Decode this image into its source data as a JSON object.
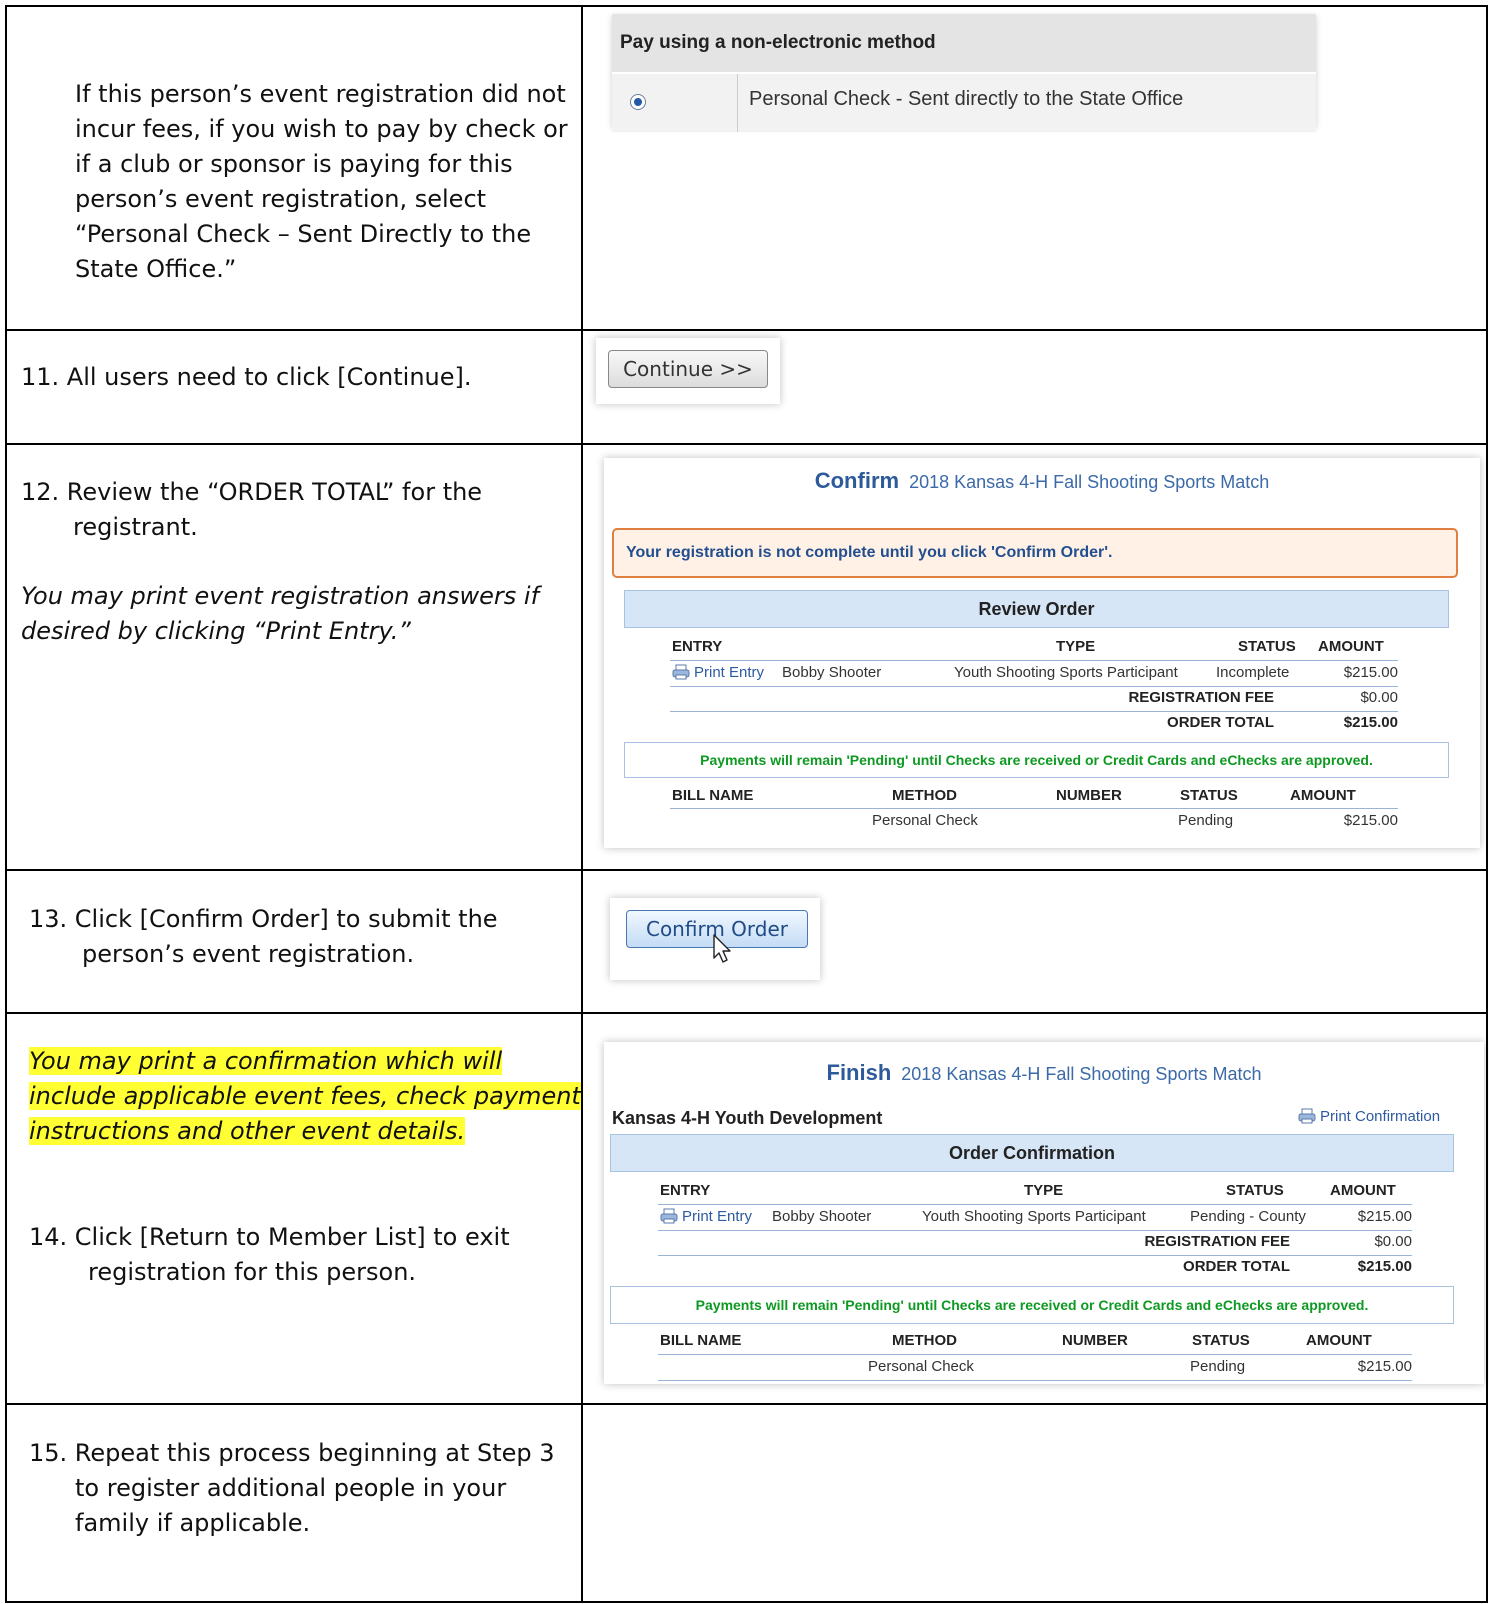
{
  "rows": [
    {
      "text": [
        "If this person’s event registration did not",
        "incur fees, if you wish to pay by check or",
        "if a club or sponsor is paying for this",
        "person’s event registration, select",
        "“Personal Check – Sent Directly to the",
        "State Office.”"
      ]
    },
    {
      "text": "11.  All users need to click [Continue]."
    },
    {
      "text": [
        "12.  Review the “ORDER TOTAL” for the",
        "registrant."
      ],
      "italic": [
        "You may print event registration answers if",
        "desired by clicking “Print Entry.”"
      ]
    },
    {
      "text": [
        "13.  Click [Confirm Order] to submit the",
        "person’s event registration."
      ]
    },
    {
      "highlight": [
        "You may print a confirmation which will",
        "include applicable event fees, check payment",
        "instructions and other event details."
      ],
      "text": [
        "14.   Click [Return to Member List] to exit",
        "registration for this person."
      ]
    },
    {
      "text": [
        "15.  Repeat this process beginning at Step 3",
        "to register additional people in your",
        "family if applicable."
      ]
    }
  ],
  "payment": {
    "heading": "Pay using a non-electronic method",
    "option": "Personal Check - Sent directly to the State Office"
  },
  "continue_label": "Continue >>",
  "confirm_label": "Confirm Order",
  "confirm": {
    "title": "Confirm",
    "event": "2018 Kansas 4-H Fall Shooting Sports Match",
    "warning": "Your registration is not complete until you click 'Confirm Order'.",
    "section": "Review Order",
    "headers": {
      "entry": "ENTRY",
      "type": "TYPE",
      "status": "STATUS",
      "amount": "AMOUNT"
    },
    "row": {
      "print": "Print Entry",
      "name": "Bobby Shooter",
      "type": "Youth Shooting Sports Participant",
      "status": "Incomplete",
      "amount": "$215.00"
    },
    "fee_label": "REGISTRATION FEE",
    "fee": "$0.00",
    "total_label": "ORDER TOTAL",
    "total": "$215.00",
    "note": "Payments will remain 'Pending' until Checks are received or Credit Cards and eChecks are approved.",
    "bill_headers": {
      "bill": "BILL NAME",
      "method": "METHOD",
      "number": "NUMBER",
      "status": "STATUS",
      "amount": "AMOUNT"
    },
    "bill_row": {
      "method": "Personal Check",
      "status": "Pending",
      "amount": "$215.00"
    }
  },
  "finish": {
    "title": "Finish",
    "event": "2018 Kansas 4-H Fall Shooting Sports Match",
    "org": "Kansas 4-H Youth Development",
    "print_conf": "Print Confirmation",
    "section": "Order Confirmation",
    "headers": {
      "entry": "ENTRY",
      "type": "TYPE",
      "status": "STATUS",
      "amount": "AMOUNT"
    },
    "row": {
      "print": "Print Entry",
      "name": "Bobby Shooter",
      "type": "Youth Shooting Sports Participant",
      "status": "Pending - County",
      "amount": "$215.00"
    },
    "fee_label": "REGISTRATION FEE",
    "fee": "$0.00",
    "total_label": "ORDER TOTAL",
    "total": "$215.00",
    "note": "Payments will remain 'Pending' until Checks are received or Credit Cards and eChecks are approved.",
    "bill_headers": {
      "bill": "BILL NAME",
      "method": "METHOD",
      "number": "NUMBER",
      "status": "STATUS",
      "amount": "AMOUNT"
    },
    "bill_row": {
      "method": "Personal Check",
      "status": "Pending",
      "amount": "$215.00"
    }
  }
}
